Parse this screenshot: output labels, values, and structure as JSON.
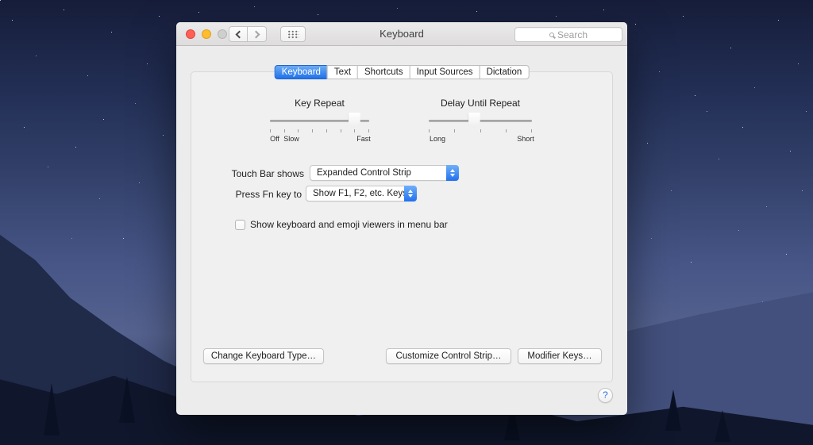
{
  "window": {
    "title": "Keyboard",
    "toolbar": {
      "search_placeholder": "Search"
    },
    "tabs": [
      {
        "label": "Keyboard",
        "selected": true
      },
      {
        "label": "Text",
        "selected": false
      },
      {
        "label": "Shortcuts",
        "selected": false
      },
      {
        "label": "Input Sources",
        "selected": false
      },
      {
        "label": "Dictation",
        "selected": false
      }
    ],
    "key_repeat": {
      "title": "Key Repeat",
      "ticks": 8,
      "value_percent": 85,
      "labels": {
        "off": "Off",
        "slow": "Slow",
        "fast": "Fast"
      }
    },
    "delay_until_repeat": {
      "title": "Delay Until Repeat",
      "ticks": 5,
      "value_percent": 44,
      "labels": {
        "long": "Long",
        "short": "Short"
      }
    },
    "touch_bar_shows": {
      "label": "Touch Bar shows",
      "value": "Expanded Control Strip"
    },
    "press_fn_key": {
      "label": "Press Fn key to",
      "value": "Show F1, F2, etc. Keys"
    },
    "show_viewers_checkbox": {
      "label": "Show keyboard and emoji viewers in menu bar",
      "checked": false
    },
    "footer_buttons": {
      "change_keyboard_type": "Change Keyboard Type…",
      "customize_control_strip": "Customize Control Strip…",
      "modifier_keys": "Modifier Keys…"
    },
    "help_label": "?"
  },
  "colors": {
    "accent_blue": "#2071e9",
    "traffic_red": "#ff5f57",
    "traffic_yellow": "#febc2e",
    "traffic_disabled": "#cfcfcd"
  }
}
